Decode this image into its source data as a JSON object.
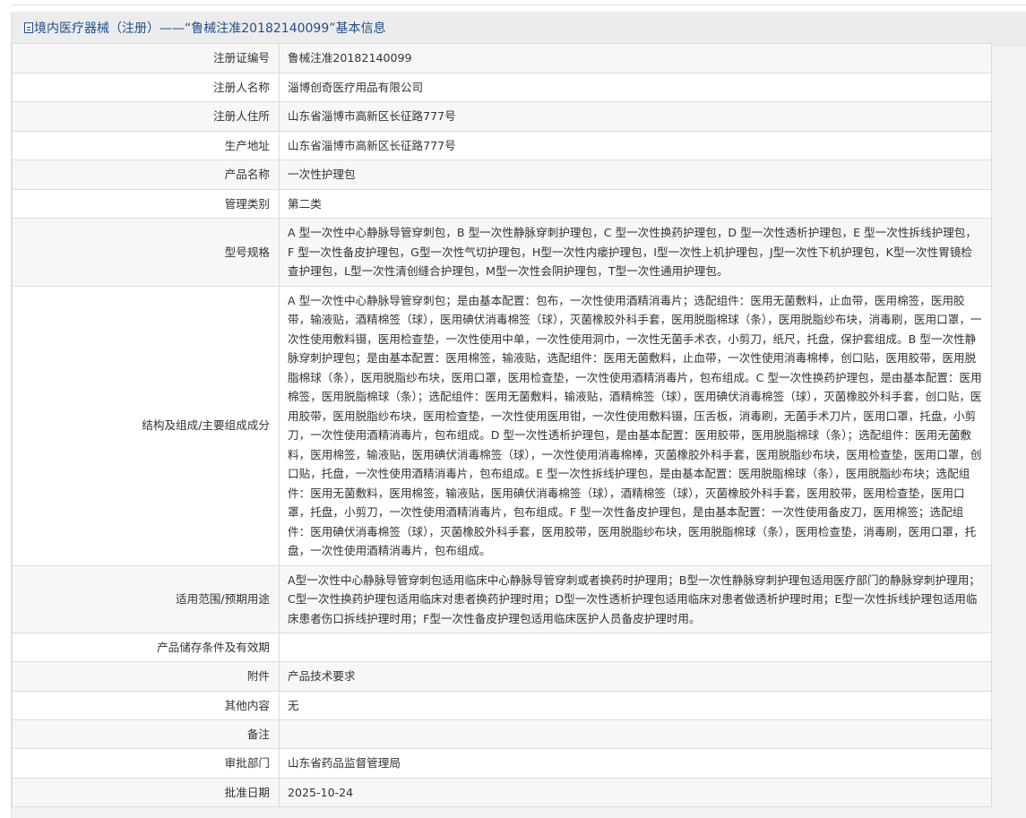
{
  "header": {
    "title": "境内医疗器械（注册）——“鲁械注准20182140099”基本信息"
  },
  "rows": [
    {
      "label": "注册证编号",
      "value": "鲁械注准20182140099"
    },
    {
      "label": "注册人名称",
      "value": "淄博创奇医疗用品有限公司"
    },
    {
      "label": "注册人住所",
      "value": "山东省淄博市高新区长征路777号"
    },
    {
      "label": "生产地址",
      "value": "山东省淄博市高新区长征路777号"
    },
    {
      "label": "产品名称",
      "value": "一次性护理包"
    },
    {
      "label": "管理类别",
      "value": "第二类"
    },
    {
      "label": "型号规格",
      "value": "A 型一次性中心静脉导管穿刺包，B 型一次性静脉穿刺护理包，C 型一次性换药护理包，D 型一次性透析护理包，E 型一次性拆线护理包，F 型一次性备皮护理包，G型一次性气切护理包，H型一次性内瘘护理包，I型一次性上机护理包，J型一次性下机护理包，K型一次性胃镜检查护理包，L型一次性清创缝合护理包，M型一次性会阴护理包，T型一次性通用护理包。"
    },
    {
      "label": "结构及组成/主要组成成分",
      "value": "A 型一次性中心静脉导管穿刺包；是由基本配置：包布，一次性使用酒精消毒片；选配组件：医用无菌敷料，止血带，医用棉签，医用胶带，输液贴，酒精棉签（球），医用碘伏消毒棉签（球），灭菌橡胶外科手套，医用脱脂棉球（条），医用脱脂纱布块，消毒刷，医用口罩，一次性使用敷料镊，医用检查垫，一次性使用中单，一次性使用洞巾，一次性无菌手术衣，小剪刀，纸尺，托盘，保护套组成。B 型一次性静脉穿刺护理包；是由基本配置：医用棉签，输液贴，选配组件：医用无菌敷料，止血带，一次性使用消毒棉棒，创口贴，医用胶带，医用脱脂棉球（条），医用脱脂纱布块，医用口罩，医用检查垫，一次性使用酒精消毒片，包布组成。C 型一次性换药护理包，是由基本配置：医用棉签，医用脱脂棉球（条）；选配组件：医用无菌敷料，输液贴，酒精棉签（球），医用碘伏消毒棉签（球），灭菌橡胶外科手套，创口贴，医用胶带，医用脱脂纱布块，医用检查垫，一次性使用医用钳，一次性使用敷料镊，压舌板，消毒刷，无菌手术刀片，医用口罩，托盘，小剪刀，一次性使用酒精消毒片，包布组成。D 型一次性透析护理包，是由基本配置：医用胶带，医用脱脂棉球（条）；选配组件：医用无菌敷料，医用棉签，输液贴，医用碘伏消毒棉签（球），一次性使用消毒棉棒，灭菌橡胶外科手套，医用脱脂纱布块，医用检查垫，医用口罩，创口贴，托盘，一次性使用酒精消毒片，包布组成。E 型一次性拆线护理包，是由基本配置：医用脱脂棉球（条），医用脱脂纱布块；选配组件：医用无菌敷料，医用棉签，输液贴，医用碘伏消毒棉签（球），酒精棉签（球），灭菌橡胶外科手套，医用胶带，医用检查垫，医用口罩，托盘，小剪刀，一次性使用酒精消毒片，包布组成。F 型一次性备皮护理包，是由基本配置：一次性使用备皮刀，医用棉签；选配组件：医用碘伏消毒棉签（球），灭菌橡胶外科手套，医用胶带，医用脱脂纱布块，医用脱脂棉球（条），医用检查垫，消毒刷，医用口罩，托盘，一次性使用酒精消毒片，包布组成。"
    },
    {
      "label": "适用范围/预期用途",
      "value": "A型一次性中心静脉导管穿刺包适用临床中心静脉导管穿刺或者换药时护理用；B型一次性静脉穿刺护理包适用医疗部门的静脉穿刺护理用；C型一次性换药护理包适用临床对患者换药护理时用；D型一次性透析护理包适用临床对患者做透析护理时用；E型一次性拆线护理包适用临床患者伤口拆线护理时用；F型一次性备皮护理包适用临床医护人员备皮护理时用。"
    },
    {
      "label": "产品储存条件及有效期",
      "value": ""
    },
    {
      "label": "附件",
      "value": "产品技术要求"
    },
    {
      "label": "其他内容",
      "value": "无"
    },
    {
      "label": "备注",
      "value": ""
    },
    {
      "label": "审批部门",
      "value": "山东省药品监督管理局"
    },
    {
      "label": "批准日期",
      "value": "2025-10-24"
    }
  ]
}
